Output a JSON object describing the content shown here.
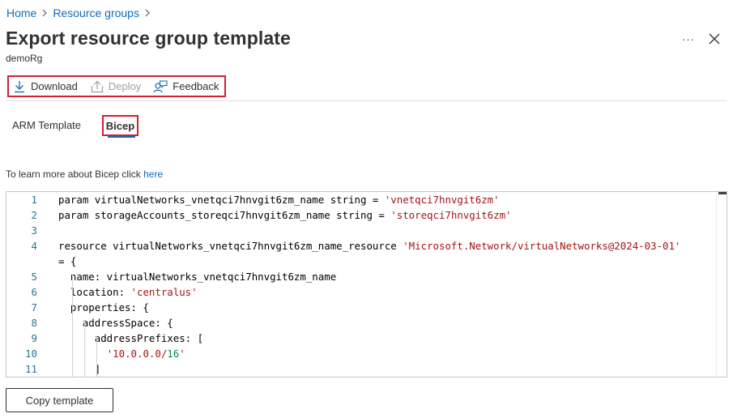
{
  "breadcrumb": {
    "items": [
      {
        "label": "Home"
      },
      {
        "label": "Resource groups"
      }
    ]
  },
  "page": {
    "title": "Export resource group template",
    "subtitle": "demoRg"
  },
  "header_actions": {
    "more": "···"
  },
  "toolbar": {
    "download": "Download",
    "deploy": "Deploy",
    "feedback": "Feedback"
  },
  "tabs": [
    {
      "label": "ARM Template"
    },
    {
      "label": "Bicep",
      "selected": true
    }
  ],
  "learn_more": {
    "text": "To learn more about Bicep click ",
    "link": "here"
  },
  "code_lines": [
    {
      "num": "1",
      "parts": [
        {
          "t": "param virtualNetworks_vnetqci7hnvgit6zm_name string = "
        },
        {
          "t": "'vnetqci7hnvgit6zm'",
          "c": "str"
        }
      ]
    },
    {
      "num": "2",
      "parts": [
        {
          "t": "param storageAccounts_storeqci7hnvgit6zm_name string = "
        },
        {
          "t": "'storeqci7hnvgit6zm'",
          "c": "str"
        }
      ]
    },
    {
      "num": "3",
      "parts": []
    },
    {
      "num": "4",
      "parts": [
        {
          "t": "resource virtualNetworks_vnetqci7hnvgit6zm_name_resource "
        },
        {
          "t": "'Microsoft.Network/virtualNetworks@2024-03-01'",
          "c": "str"
        }
      ]
    },
    {
      "num": "",
      "parts": [
        {
          "t": "= {"
        }
      ]
    },
    {
      "num": "5",
      "parts": [
        {
          "t": "  name: virtualNetworks_vnetqci7hnvgit6zm_name"
        }
      ]
    },
    {
      "num": "6",
      "parts": [
        {
          "t": "  location: "
        },
        {
          "t": "'centralus'",
          "c": "str"
        }
      ]
    },
    {
      "num": "7",
      "parts": [
        {
          "t": "  properties: {"
        }
      ]
    },
    {
      "num": "8",
      "parts": [
        {
          "t": "    addressSpace: {"
        }
      ]
    },
    {
      "num": "9",
      "parts": [
        {
          "t": "      addressPrefixes: ["
        }
      ]
    },
    {
      "num": "10",
      "parts": [
        {
          "t": "        "
        },
        {
          "t": "'10.0.0.0/",
          "c": "str"
        },
        {
          "t": "16",
          "c": "num"
        },
        {
          "t": "'",
          "c": "str"
        }
      ]
    },
    {
      "num": "11",
      "parts": [
        {
          "t": "      ]"
        }
      ]
    }
  ],
  "copy_button": {
    "label": "Copy template"
  },
  "colors": {
    "accent": "#0f6cbd",
    "highlight_border": "#d1202f",
    "string": "#a31515",
    "number": "#098658",
    "line_number": "#237893"
  },
  "icons": {
    "download": "download-icon",
    "deploy": "deploy-icon",
    "feedback": "feedback-icon",
    "close": "close-icon",
    "more": "more-icon",
    "chevron": "chevron-right-icon"
  }
}
